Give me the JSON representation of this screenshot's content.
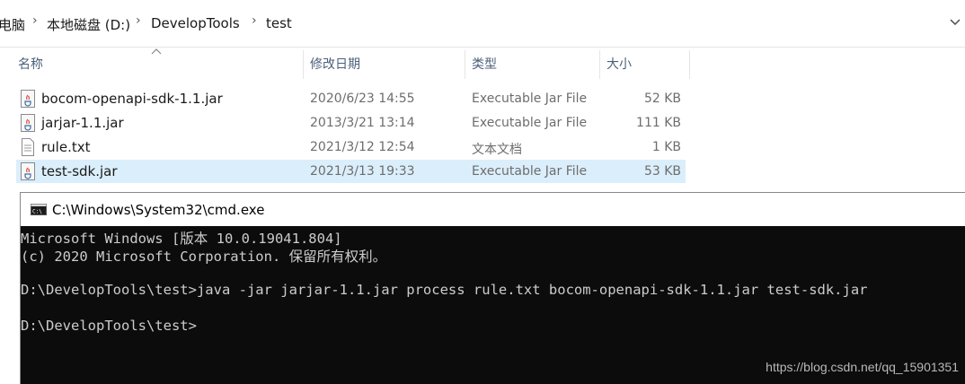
{
  "breadcrumb": {
    "items": [
      "电脑",
      "本地磁盘 (D:)",
      "DevelopTools",
      "test"
    ],
    "separator_icon": "chevron-right-icon",
    "dropdown_icon": "chevron-down-icon"
  },
  "columns": {
    "name": "名称",
    "modified": "修改日期",
    "type": "类型",
    "size": "大小"
  },
  "files": [
    {
      "name": "bocom-openapi-sdk-1.1.jar",
      "modified": "2020/6/23 14:55",
      "type": "Executable Jar File",
      "size": "52 KB",
      "icon": "java-jar-icon",
      "selected": false
    },
    {
      "name": "jarjar-1.1.jar",
      "modified": "2013/3/21 13:14",
      "type": "Executable Jar File",
      "size": "111 KB",
      "icon": "java-jar-icon",
      "selected": false
    },
    {
      "name": "rule.txt",
      "modified": "2021/3/12 12:54",
      "type": "文本文档",
      "size": "1 KB",
      "icon": "text-file-icon",
      "selected": false
    },
    {
      "name": "test-sdk.jar",
      "modified": "2021/3/13 19:33",
      "type": "Executable Jar File",
      "size": "53 KB",
      "icon": "java-jar-icon",
      "selected": true
    }
  ],
  "cmd": {
    "title": "C:\\Windows\\System32\\cmd.exe",
    "lines": [
      "Microsoft Windows [版本 10.0.19041.804]",
      "(c) 2020 Microsoft Corporation. 保留所有权利。",
      "",
      "D:\\DevelopTools\\test>java -jar jarjar-1.1.jar process rule.txt bocom-openapi-sdk-1.1.jar test-sdk.jar",
      "",
      "D:\\DevelopTools\\test>"
    ]
  },
  "watermark": "https://blog.csdn.net/qq_15901351",
  "colors": {
    "selected_row": "#dbeefb",
    "console_bg": "#0c0c0c",
    "console_text": "#cccccc",
    "header_text": "#4c607a"
  }
}
